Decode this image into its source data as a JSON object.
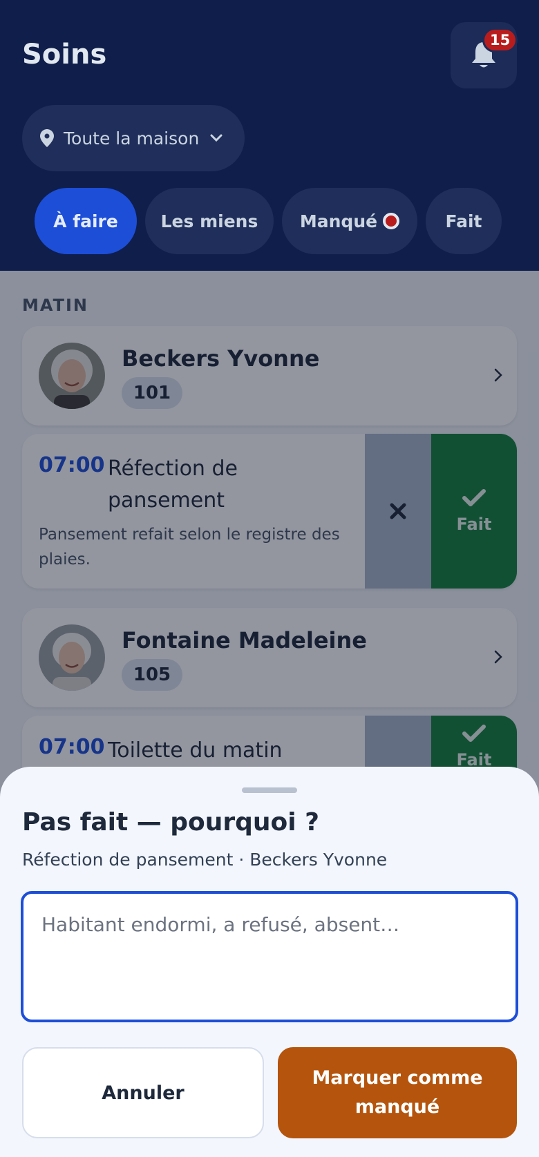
{
  "header": {
    "title": "Soins",
    "notifications_count": "15",
    "location_label": "Toute la maison"
  },
  "tabs": [
    {
      "label": "À faire",
      "active": true
    },
    {
      "label": "Les miens",
      "active": false
    },
    {
      "label": "Manqué",
      "active": false,
      "has_alert_dot": true
    },
    {
      "label": "Fait",
      "active": false
    }
  ],
  "section_label": "MATIN",
  "residents": [
    {
      "name": "Beckers Yvonne",
      "room": "101",
      "task": {
        "time": "07:00",
        "title": "Réfection de pansement",
        "description": "Pansement refait selon le registre des plaies.",
        "done_label": "Fait"
      }
    },
    {
      "name": "Fontaine Madeleine",
      "room": "105",
      "task": {
        "time": "07:00",
        "title": "Toilette du matin",
        "done_label": "Fait"
      }
    }
  ],
  "sheet": {
    "title": "Pas fait — pourquoi ?",
    "subtitle": "Réfection de pansement · Beckers Yvonne",
    "reason_placeholder": "Habitant endormi, a refusé, absent…",
    "reason_value": "",
    "cancel_label": "Annuler",
    "confirm_label": "Marquer comme manqué"
  },
  "colors": {
    "header_bg": "#0f1e4a",
    "accent": "#1d4ed8",
    "done": "#15803d",
    "missed": "#b5540c",
    "alert": "#b91c1c"
  }
}
